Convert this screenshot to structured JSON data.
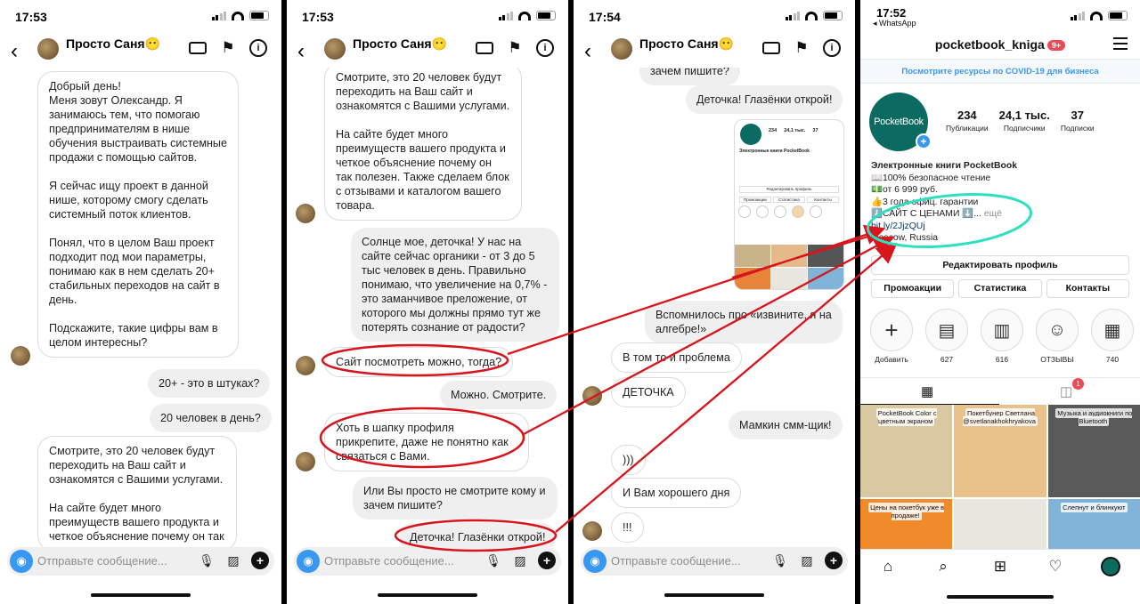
{
  "chat": {
    "name": "Просто Саня😶",
    "composer_placeholder": "Отправьте сообщение..."
  },
  "panels": [
    {
      "time": "17:53",
      "messages": [
        {
          "side": "in",
          "paras": [
            "Добрый день!\nМеня зовут Олександр. Я занимаюсь тем, что помогаю предпринимателям в нише обучения выстраивать системные продажи с помощью сайтов.",
            "Я сейчас ищу проект в данной нише, которому смогу сделать системный поток клиентов.",
            "Понял, что в целом Ваш проект подходит под мои параметры, понимаю как в нем сделать 20+ стабильных переходов на сайт в день.",
            "Подскажите, такие цифры вам в целом интересны?"
          ]
        },
        {
          "side": "out",
          "paras": [
            "20+ - это в штуках?"
          ]
        },
        {
          "side": "out",
          "paras": [
            "20 человек в день?"
          ]
        },
        {
          "side": "in",
          "paras": [
            "Смотрите, это 20 человек будут переходить на Ваш сайт и ознакомятся с Вашими услугами.",
            "На сайте будет много преимуществ вашего продукта и четкое объяснение почему он так"
          ]
        }
      ]
    },
    {
      "time": "17:53",
      "messages": [
        {
          "side": "in",
          "paras": [
            "Смотрите, это 20 человек будут переходить на Ваш сайт и ознакомятся с Вашими услугами.",
            "На сайте будет много преимуществ вашего продукта и четкое объяснение почему он так полезен. Также сделаем блок с отзывами и каталогом вашего товара."
          ]
        },
        {
          "side": "out",
          "paras": [
            "Солнце мое, деточка! У нас на сайте сейчас органики - от 3 до 5 тыс человек в день. Правильно понимаю, что увеличение на 0,7% - это заманчивое преложение, от которого мы должны прямо тут же потерять сознание от радости?"
          ]
        },
        {
          "side": "in",
          "paras": [
            "Сайт посмотреть можно, тогда?"
          ]
        },
        {
          "side": "out",
          "paras": [
            "Можно. Смотрите."
          ]
        },
        {
          "side": "in",
          "paras": [
            "Хоть в шапку профиля прикрепите, даже не понятно как связаться с Вами."
          ]
        },
        {
          "side": "out",
          "paras": [
            "Или Вы просто не смотрите кому и зачем пишите?"
          ]
        },
        {
          "side": "out",
          "paras": [
            "Деточка! Глазёнки открой!"
          ]
        }
      ]
    },
    {
      "time": "17:54",
      "messages": [
        {
          "side": "out",
          "paras": [
            "зачем пишите?"
          ]
        },
        {
          "side": "out",
          "paras": [
            "Деточка! Глазёнки открой!"
          ]
        },
        {
          "side": "out",
          "paras": [
            "Вспомнилось про «извините, я на алгебре!»"
          ]
        },
        {
          "side": "in",
          "paras": [
            "В том то и проблема"
          ]
        },
        {
          "side": "in",
          "paras": [
            "ДЕТОЧКА"
          ]
        },
        {
          "side": "out",
          "paras": [
            "Мамкин смм-щик!"
          ]
        },
        {
          "side": "in",
          "paras": [
            ")))"
          ]
        },
        {
          "side": "in",
          "paras": [
            "И Вам хорошего дня"
          ]
        },
        {
          "side": "in",
          "paras": [
            "!!!"
          ]
        }
      ],
      "shared_screenshot": {
        "stats": [
          "234",
          "24,1 тыс.",
          "37"
        ],
        "bio": "Электронные книги PocketBook",
        "edit": "Редактировать профиль",
        "tabs": [
          "Промоакции",
          "Статистика",
          "Контакты"
        ]
      }
    }
  ],
  "profile": {
    "time": "17:52",
    "back_app": "◂ WhatsApp",
    "username": "pocketbook_kniga",
    "badge": "9+",
    "covid_banner": "Посмотрите ресурсы по COVID-19 для бизнеса",
    "logo_text": "PocketBook",
    "stats": [
      {
        "value": "234",
        "label": "Публикации"
      },
      {
        "value": "24,1 тыс.",
        "label": "Подписчики"
      },
      {
        "value": "37",
        "label": "Подписки"
      }
    ],
    "bio_name": "Электронные книги PocketBook",
    "bio_lines": [
      "📖100% безопасное чтение",
      "💵от 6 999 руб.",
      "👍3 года офиц. гарантии"
    ],
    "bio_cta": "⬇️САЙТ С ЦЕНАМИ ⬇️...",
    "bio_more": "ещё",
    "link": "bit.ly/2JjzQUj",
    "location": "Moscow, Russia",
    "edit_button": "Редактировать профиль",
    "buttons": [
      "Промоакции",
      "Статистика",
      "Контакты"
    ],
    "highlights": [
      {
        "label": "Добавить",
        "icon": "plus-icon"
      },
      {
        "label": "627",
        "icon": "reader-icon"
      },
      {
        "label": "616",
        "icon": "reader-icon"
      },
      {
        "label": "ОТЗЫВЫ",
        "icon": "face-icon"
      },
      {
        "label": "740",
        "icon": "reader-icon"
      }
    ],
    "tagged_count": "1",
    "grid": [
      {
        "caption": "PocketBook Color с цветным экраном",
        "color": "#d9c8a0"
      },
      {
        "caption": "Покетбунер Светлана @svetlanakhokhryakova",
        "color": "#e8c28a"
      },
      {
        "caption": "Музыка и аудиокниги по Bluetooth",
        "color": "#5a5a5a"
      },
      {
        "caption": "Цены на покетбук уже в продаже!",
        "color": "#f08a2a"
      },
      {
        "caption": "",
        "color": "#e9e6e0"
      },
      {
        "caption": "Слепнут и блинкуют",
        "color": "#7fb3d8"
      }
    ]
  },
  "accent": {
    "annotation": "#d8141c",
    "highlight": "#2de0c0",
    "link": "#3897f0"
  }
}
